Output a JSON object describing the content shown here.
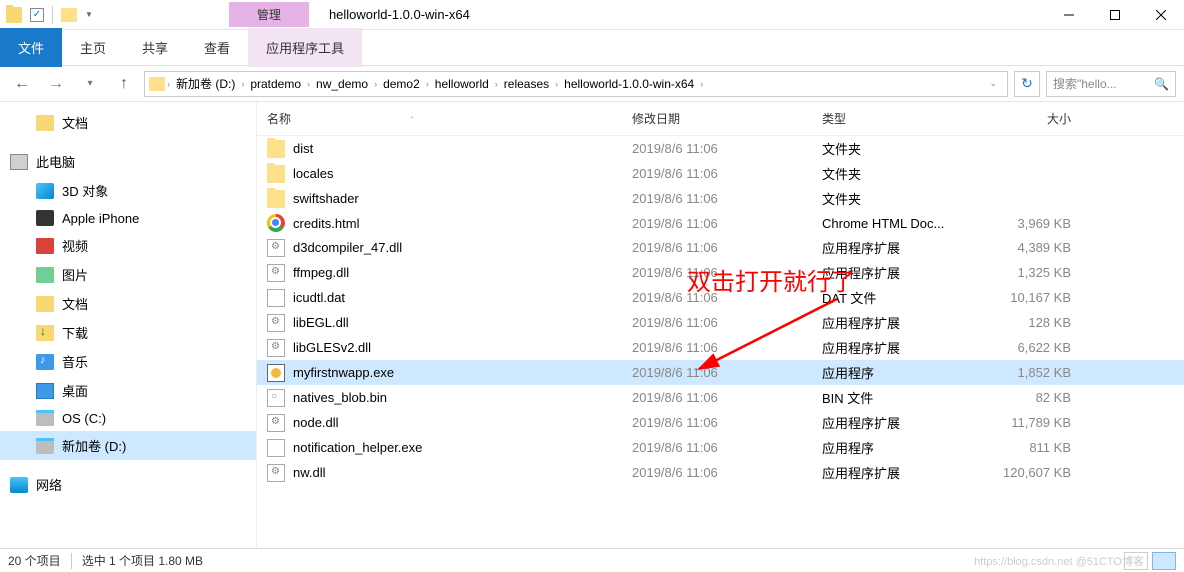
{
  "window": {
    "title": "helloworld-1.0.0-win-x64",
    "manage_label": "管理"
  },
  "tabs": {
    "file": "文件",
    "home": "主页",
    "share": "共享",
    "view": "查看",
    "apptools": "应用程序工具"
  },
  "breadcrumb": [
    "新加卷 (D:)",
    "pratdemo",
    "nw_demo",
    "demo2",
    "helloworld",
    "releases",
    "helloworld-1.0.0-win-x64"
  ],
  "search": {
    "placeholder": "搜索\"hello..."
  },
  "columns": {
    "name": "名称",
    "date": "修改日期",
    "type": "类型",
    "size": "大小"
  },
  "sidebar": [
    {
      "label": "文档",
      "icon": "ico-docs",
      "level": 1
    },
    {
      "label": "此电脑",
      "icon": "ico-pc",
      "level": 0
    },
    {
      "label": "3D 对象",
      "icon": "ico-3d",
      "level": 1
    },
    {
      "label": "Apple iPhone",
      "icon": "ico-phone",
      "level": 1
    },
    {
      "label": "视频",
      "icon": "ico-video",
      "level": 1
    },
    {
      "label": "图片",
      "icon": "ico-pics",
      "level": 1
    },
    {
      "label": "文档",
      "icon": "ico-docs",
      "level": 1
    },
    {
      "label": "下载",
      "icon": "ico-dl",
      "level": 1
    },
    {
      "label": "音乐",
      "icon": "ico-music",
      "level": 1
    },
    {
      "label": "桌面",
      "icon": "ico-desktop",
      "level": 1
    },
    {
      "label": "OS (C:)",
      "icon": "ico-drive",
      "level": 1
    },
    {
      "label": "新加卷 (D:)",
      "icon": "ico-drive",
      "level": 1,
      "selected": true
    },
    {
      "label": "网络",
      "icon": "ico-net",
      "level": 0
    }
  ],
  "files": [
    {
      "name": "dist",
      "date": "2019/8/6 11:06",
      "type": "文件夹",
      "size": "",
      "icon": "fic-folder"
    },
    {
      "name": "locales",
      "date": "2019/8/6 11:06",
      "type": "文件夹",
      "size": "",
      "icon": "fic-folder"
    },
    {
      "name": "swiftshader",
      "date": "2019/8/6 11:06",
      "type": "文件夹",
      "size": "",
      "icon": "fic-folder"
    },
    {
      "name": "credits.html",
      "date": "2019/8/6 11:06",
      "type": "Chrome HTML Doc...",
      "size": "3,969 KB",
      "icon": "fic-chrome"
    },
    {
      "name": "d3dcompiler_47.dll",
      "date": "2019/8/6 11:06",
      "type": "应用程序扩展",
      "size": "4,389 KB",
      "icon": "fic-dll"
    },
    {
      "name": "ffmpeg.dll",
      "date": "2019/8/6 11:06",
      "type": "应用程序扩展",
      "size": "1,325 KB",
      "icon": "fic-dll"
    },
    {
      "name": "icudtl.dat",
      "date": "2019/8/6 11:06",
      "type": "DAT 文件",
      "size": "10,167 KB",
      "icon": "fic-dat"
    },
    {
      "name": "libEGL.dll",
      "date": "2019/8/6 11:06",
      "type": "应用程序扩展",
      "size": "128 KB",
      "icon": "fic-dll"
    },
    {
      "name": "libGLESv2.dll",
      "date": "2019/8/6 11:06",
      "type": "应用程序扩展",
      "size": "6,622 KB",
      "icon": "fic-dll"
    },
    {
      "name": "myfirstnwapp.exe",
      "date": "2019/8/6 11:06",
      "type": "应用程序",
      "size": "1,852 KB",
      "icon": "fic-exe",
      "selected": true
    },
    {
      "name": "natives_blob.bin",
      "date": "2019/8/6 11:06",
      "type": "BIN 文件",
      "size": "82 KB",
      "icon": "fic-bin"
    },
    {
      "name": "node.dll",
      "date": "2019/8/6 11:06",
      "type": "应用程序扩展",
      "size": "11,789 KB",
      "icon": "fic-dll"
    },
    {
      "name": "notification_helper.exe",
      "date": "2019/8/6 11:06",
      "type": "应用程序",
      "size": "811 KB",
      "icon": "fic-dat"
    },
    {
      "name": "nw.dll",
      "date": "2019/8/6 11:06",
      "type": "应用程序扩展",
      "size": "120,607 KB",
      "icon": "fic-dll"
    }
  ],
  "status": {
    "count": "20 个项目",
    "selection": "选中 1 个项目  1.80 MB"
  },
  "annotation": {
    "text": "双击打开就行了"
  },
  "watermark": "https://blog.csdn.net   @51CTO博客"
}
